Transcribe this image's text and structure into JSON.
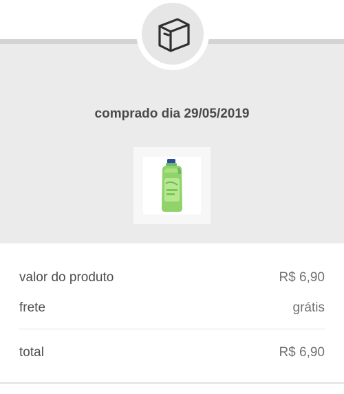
{
  "header": {
    "icon": "package-box-icon"
  },
  "order": {
    "purchase_date_text": "comprado dia 29/05/2019",
    "product_image": "green-bottle-product-icon"
  },
  "summary": {
    "product_value_label": "valor do produto",
    "product_value": "R$ 6,90",
    "shipping_label": "frete",
    "shipping_value": "grátis",
    "total_label": "total",
    "total_value": "R$ 6,90"
  },
  "colors": {
    "panel_background": "#ebebeb",
    "rule": "#d3d3d3",
    "text": "#4d4d4d",
    "value_text": "#707070",
    "product_green": "#8fd36a"
  }
}
